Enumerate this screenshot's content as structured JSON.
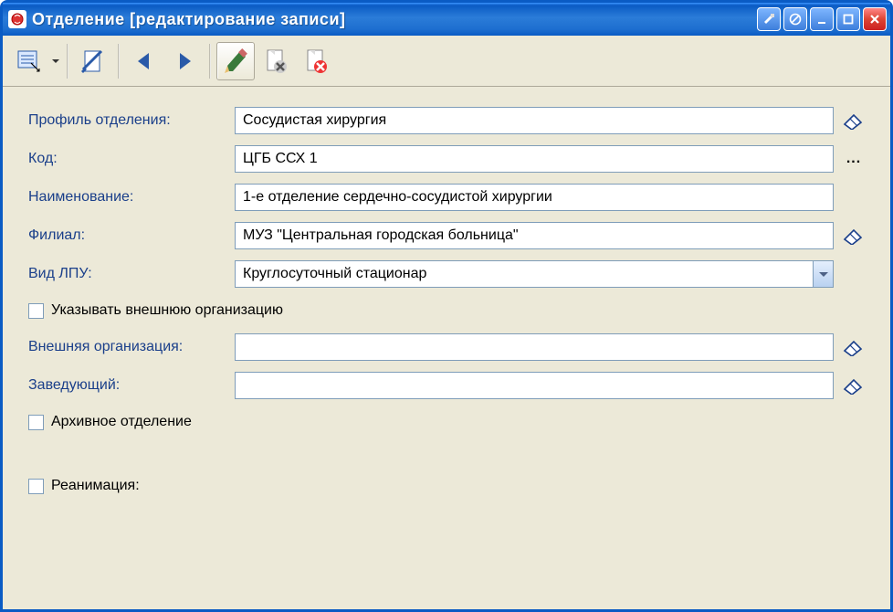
{
  "window": {
    "title": "Отделение [редактирование записи]"
  },
  "form": {
    "profile": {
      "label": "Профиль отделения:",
      "value": "Сосудистая хирургия"
    },
    "code": {
      "label": "Код:",
      "value": "ЦГБ ССХ 1"
    },
    "name": {
      "label": "Наименование:",
      "value": "1-е отделение сердечно-сосудистой хирургии"
    },
    "branch": {
      "label": "Филиал:",
      "value": "МУЗ \"Центральная городская больница\""
    },
    "lpu_type": {
      "label": "Вид ЛПУ:",
      "value": "Круглосуточный стационар"
    },
    "external_org_check": {
      "label": "Указывать внешнюю организацию"
    },
    "external_org": {
      "label": "Внешняя организация:",
      "value": ""
    },
    "head": {
      "label": "Заведующий:",
      "value": ""
    },
    "archive_check": {
      "label": "Архивное отделение"
    },
    "reanimation_check": {
      "label": "Реанимация:"
    }
  }
}
